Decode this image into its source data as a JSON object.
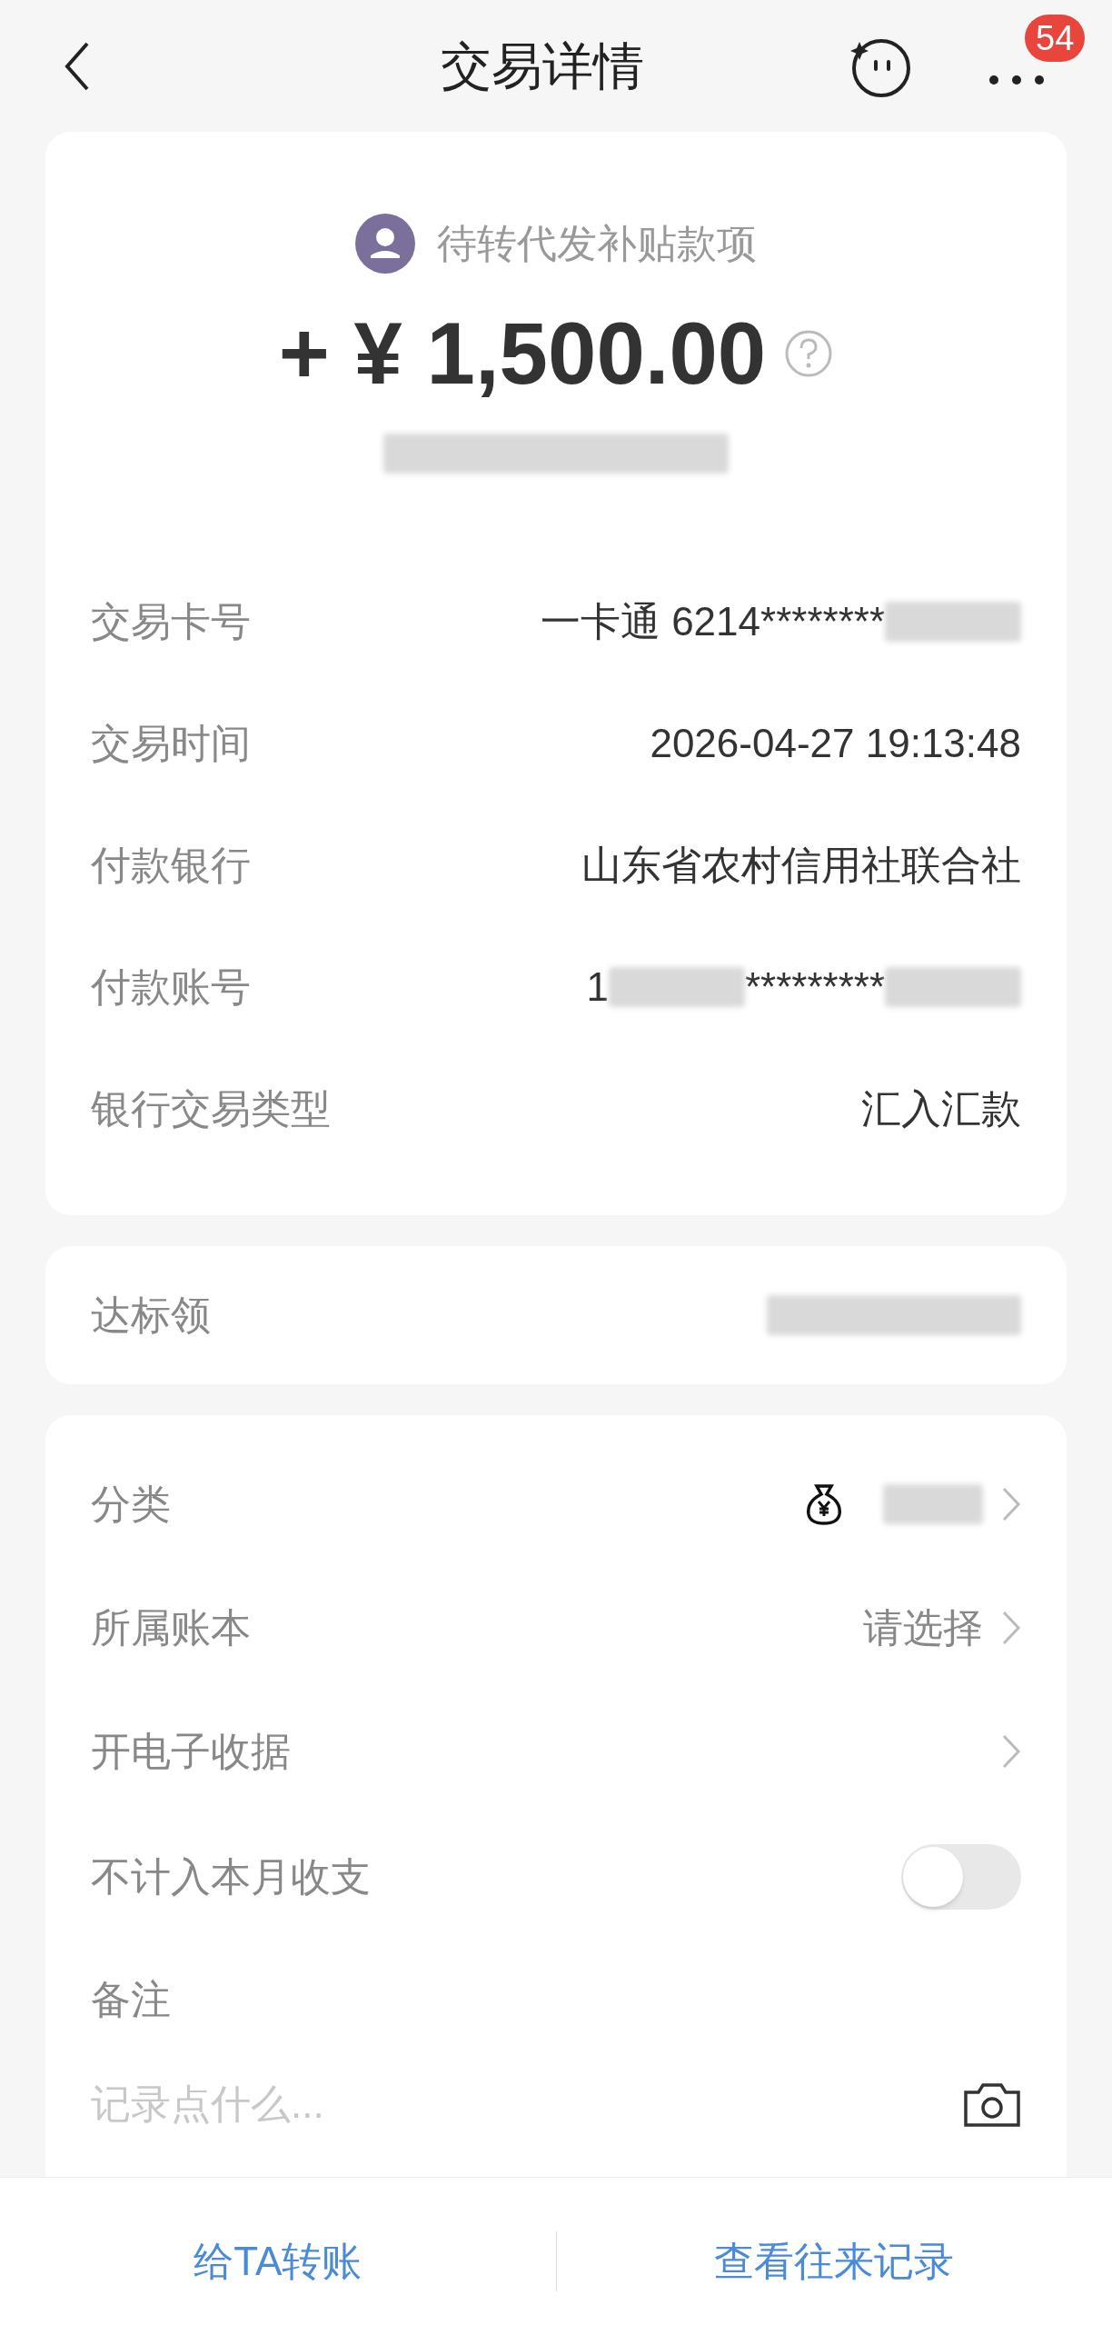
{
  "header": {
    "title": "交易详情",
    "badge": "54"
  },
  "summary": {
    "payee": "待转代发补贴款项",
    "amount": "+ ¥ 1,500.00",
    "counterparty_redacted": true
  },
  "details": [
    {
      "label": "交易卡号",
      "parts": [
        {
          "kind": "text",
          "text": "一卡通 6214********"
        },
        {
          "kind": "redacted"
        }
      ]
    },
    {
      "label": "交易时间",
      "parts": [
        {
          "kind": "text",
          "text": "2026-04-27 19:13:48"
        }
      ]
    },
    {
      "label": "付款银行",
      "parts": [
        {
          "kind": "text",
          "text": "山东省农村信用社联合社"
        }
      ]
    },
    {
      "label": "付款账号",
      "parts": [
        {
          "kind": "text",
          "text": "1"
        },
        {
          "kind": "redacted"
        },
        {
          "kind": "text",
          "text": "*********"
        },
        {
          "kind": "redacted"
        }
      ]
    },
    {
      "label": "银行交易类型",
      "parts": [
        {
          "kind": "text",
          "text": "汇入汇款"
        }
      ]
    }
  ],
  "extra": [
    {
      "label": "达标领",
      "parts": [
        {
          "kind": "redacted"
        }
      ]
    }
  ],
  "settings": [
    {
      "kind": "category",
      "label": "分类",
      "redacted": true
    },
    {
      "kind": "link",
      "label": "所属账本",
      "value": "请选择"
    },
    {
      "kind": "link",
      "label": "开电子收据"
    },
    {
      "kind": "toggle",
      "label": "不计入本月收支",
      "on": false
    },
    {
      "kind": "note",
      "label": "备注",
      "placeholder": "记录点什么..."
    }
  ],
  "actions": [
    "给TA转账",
    "查看往来记录"
  ]
}
